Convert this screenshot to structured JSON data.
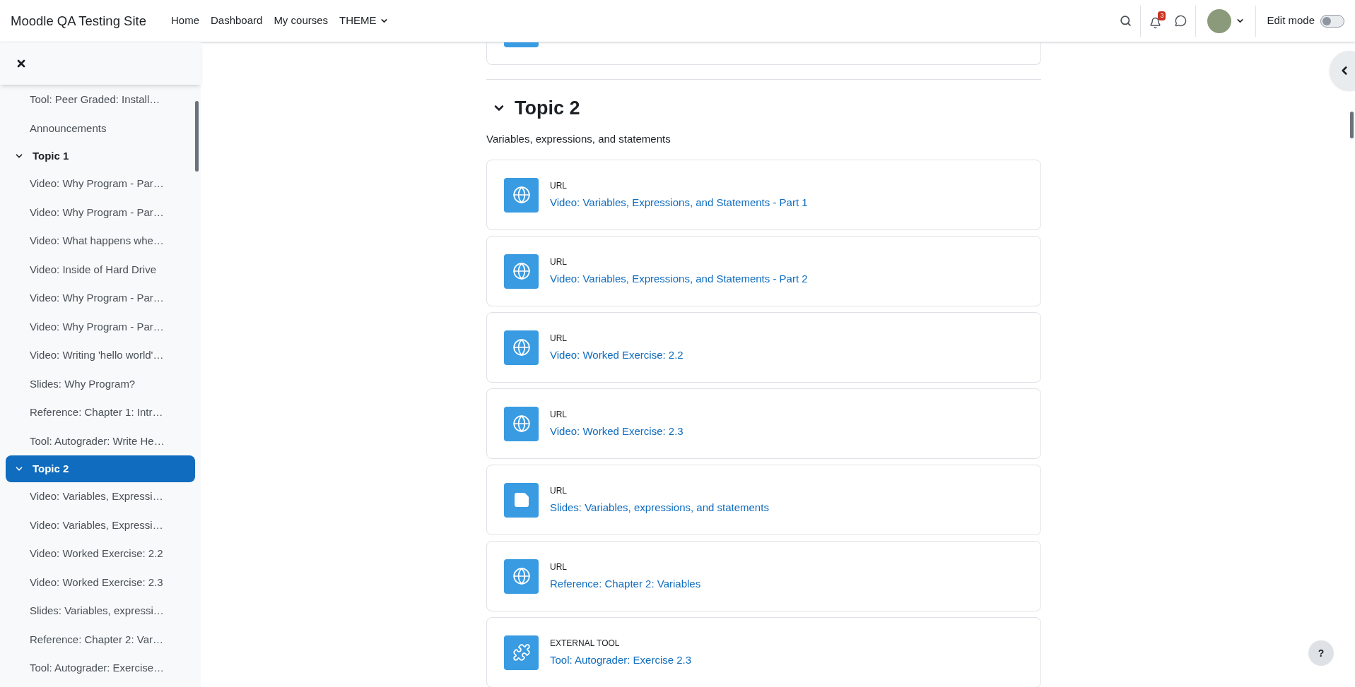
{
  "navbar": {
    "site_name": "Moodle QA Testing Site",
    "links": [
      {
        "label": "Home",
        "dropdown": false
      },
      {
        "label": "Dashboard",
        "dropdown": false
      },
      {
        "label": "My courses",
        "dropdown": false
      },
      {
        "label": "THEME",
        "dropdown": true
      }
    ],
    "notifications_count": "3",
    "edit_mode": {
      "label": "Edit mode",
      "on": false
    }
  },
  "sidebar": {
    "items": [
      {
        "kind": "activity",
        "label": "Tool: Peer Graded: Install…"
      },
      {
        "kind": "activity",
        "label": "Announcements"
      },
      {
        "kind": "section",
        "label": "Topic 1",
        "expanded": true,
        "selected": false,
        "children": [
          {
            "kind": "activity",
            "label": "Video: Why Program - Par…"
          },
          {
            "kind": "activity",
            "label": "Video: Why Program - Par…"
          },
          {
            "kind": "activity",
            "label": "Video: What happens whe…"
          },
          {
            "kind": "activity",
            "label": "Video: Inside of Hard Drive"
          },
          {
            "kind": "activity",
            "label": "Video: Why Program - Par…"
          },
          {
            "kind": "activity",
            "label": "Video: Why Program - Par…"
          },
          {
            "kind": "activity",
            "label": "Video: Writing 'hello world'…"
          },
          {
            "kind": "activity",
            "label": "Slides: Why Program?"
          },
          {
            "kind": "activity",
            "label": "Reference: Chapter 1: Intr…"
          },
          {
            "kind": "activity",
            "label": "Tool: Autograder: Write He…"
          }
        ]
      },
      {
        "kind": "section",
        "label": "Topic 2",
        "expanded": true,
        "selected": true,
        "children": [
          {
            "kind": "activity",
            "label": "Video: Variables, Expressi…"
          },
          {
            "kind": "activity",
            "label": "Video: Variables, Expressi…"
          },
          {
            "kind": "activity",
            "label": "Video: Worked Exercise: 2.2"
          },
          {
            "kind": "activity",
            "label": "Video: Worked Exercise: 2.3"
          },
          {
            "kind": "activity",
            "label": "Slides: Variables, expressi…"
          },
          {
            "kind": "activity",
            "label": "Reference: Chapter 2: Var…"
          },
          {
            "kind": "activity",
            "label": "Tool: Autograder: Exercise…"
          }
        ]
      }
    ]
  },
  "section": {
    "title": "Topic 2",
    "expanded": true,
    "summary": "Variables, expressions, and statements",
    "activities": [
      {
        "kind": "url",
        "type_label": "URL",
        "name": "Video: Variables, Expressions, and Statements - Part 1"
      },
      {
        "kind": "url",
        "type_label": "URL",
        "name": "Video: Variables, Expressions, and Statements - Part 2"
      },
      {
        "kind": "url",
        "type_label": "URL",
        "name": "Video: Worked Exercise: 2.2"
      },
      {
        "kind": "url",
        "type_label": "URL",
        "name": "Video: Worked Exercise: 2.3"
      },
      {
        "kind": "file",
        "type_label": "URL",
        "name": "Slides: Variables, expressions, and statements"
      },
      {
        "kind": "url",
        "type_label": "URL",
        "name": "Reference: Chapter 2: Variables"
      },
      {
        "kind": "lti",
        "type_label": "EXTERNAL TOOL",
        "name": "Tool: Autograder: Exercise 2.3"
      }
    ]
  },
  "help_button": {
    "label": "?"
  }
}
